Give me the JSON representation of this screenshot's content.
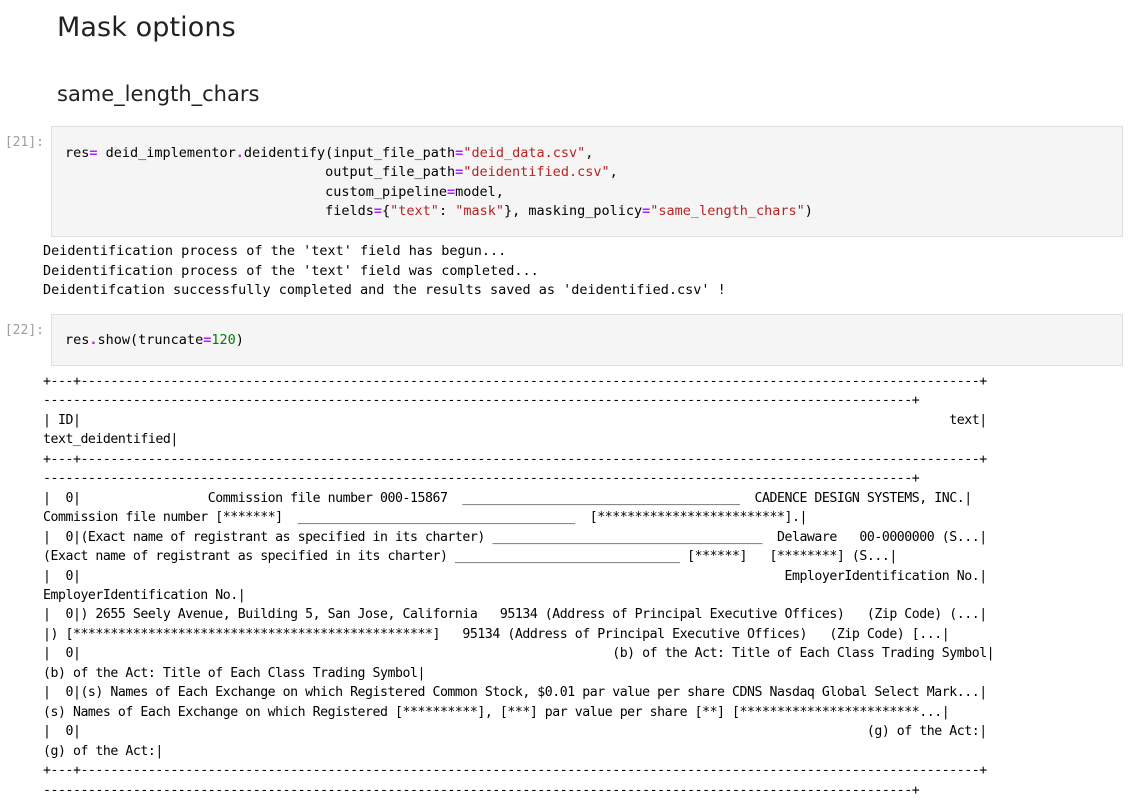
{
  "headings": {
    "title": "Mask options",
    "subtitle": "same_length_chars"
  },
  "cells": [
    {
      "prompt": "[21]:",
      "code": {
        "line1": {
          "var": "res",
          "op": "=",
          "call": " deid_implementor",
          "dot": ".",
          "fn": "deidentify(input_file_path",
          "eq": "=",
          "arg": "\"deid_data.csv\"",
          "comma": ","
        },
        "line2": {
          "indent": "                                ",
          "key": "output_file_path",
          "eq": "=",
          "arg": "\"deidentified.csv\"",
          "comma": ","
        },
        "line3": {
          "indent": "                                ",
          "key": "custom_pipeline",
          "eq": "=",
          "rest": "model,"
        },
        "line4": {
          "indent": "                                ",
          "key": "fields",
          "eq": "=",
          "open": "{",
          "k": "\"text\"",
          "colon": ": ",
          "v": "\"mask\"",
          "close": "}, masking_policy",
          "eq2": "=",
          "policy": "\"same_length_chars\"",
          "end": ")"
        }
      },
      "output": [
        "Deidentification process of the 'text' field has begun...",
        "Deidentification process of the 'text' field was completed...",
        "Deidentifcation successfully completed and the results saved as 'deidentified.csv' !"
      ]
    },
    {
      "prompt": "[22]:",
      "code": {
        "line1": {
          "obj": "res",
          "dot": ".",
          "fn": "show(truncate",
          "eq": "=",
          "num": "120",
          "end": ")"
        }
      },
      "output": [
        "+---+------------------------------------------------------------------------------------------------------------------------+",
        "--------------------------------------------------------------------------------------------------------------------+",
        "| ID|                                                                                                                    text|",
        "text_deidentified|",
        "+---+------------------------------------------------------------------------------------------------------------------------+",
        "--------------------------------------------------------------------------------------------------------------------+",
        "|  0|                 Commission file number 000-15867  _____________________________________  CADENCE DESIGN SYSTEMS, INC.|",
        "Commission file number [*******]  _____________________________________  [*************************].|",
        "|  0|(Exact name of registrant as specified in its charter) ____________________________________  Delaware   00-0000000 (S...|",
        "(Exact name of registrant as specified in its charter) ______________________________ [******]   [********] (S...|",
        "|  0|                                                                                              EmployerIdentification No.|",
        "EmployerIdentification No.|",
        "|  0|) 2655 Seely Avenue, Building 5, San Jose, California   95134 (Address of Principal Executive Offices)   (Zip Code) (...|",
        "|) [************************************************]   95134 (Address of Principal Executive Offices)   (Zip Code) [...|",
        "|  0|                                                                       (b) of the Act: Title of Each Class Trading Symbol|",
        "(b) of the Act: Title of Each Class Trading Symbol|",
        "|  0|(s) Names of Each Exchange on which Registered Common Stock, $0.01 par value per share CDNS Nasdaq Global Select Mark...|",
        "(s) Names of Each Exchange on which Registered [**********], [***] par value per share [**] [************************...|",
        "|  0|                                                                                                         (g) of the Act:|",
        "(g) of the Act:|",
        "+---+------------------------------------------------------------------------------------------------------------------------+",
        "--------------------------------------------------------------------------------------------------------------------+"
      ]
    }
  ]
}
